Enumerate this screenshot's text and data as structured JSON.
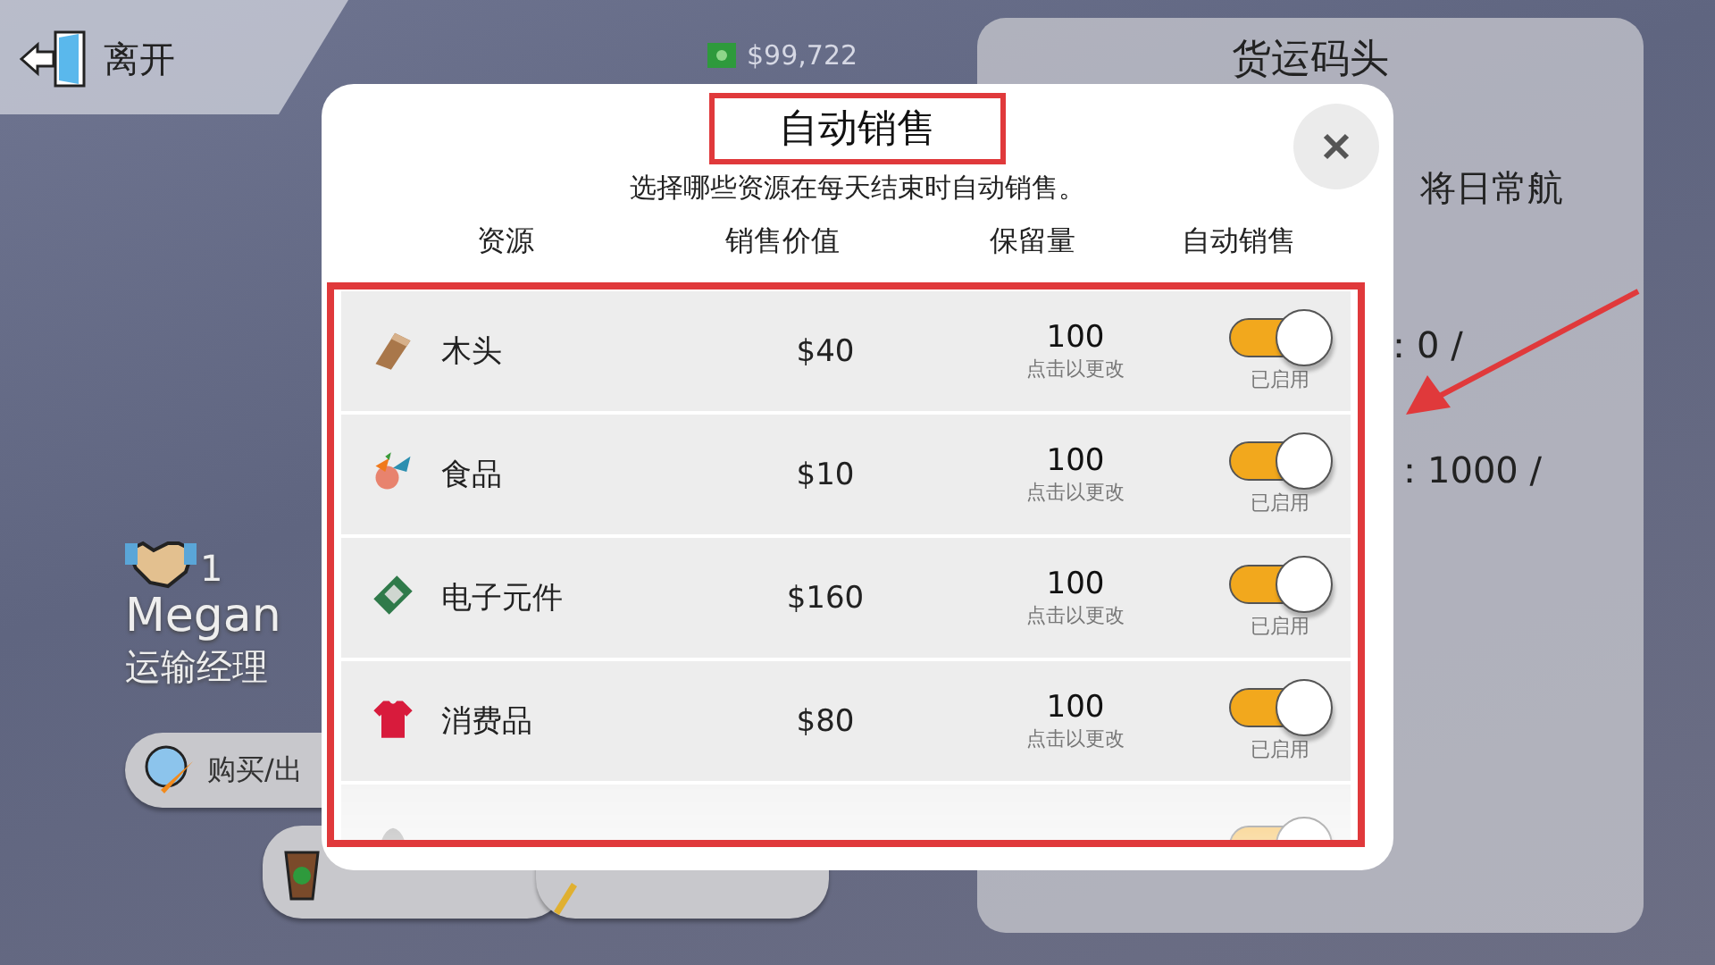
{
  "hud": {
    "exit_label": "离开",
    "money": "$99,722"
  },
  "manager": {
    "level": "1",
    "name": "Megan",
    "role": "运输经理",
    "trade_button": "购买/出"
  },
  "dock_panel": {
    "title": "货运码头",
    "line_1": "将日常航",
    "line_2": "：0 /",
    "line_3": "：1000 /"
  },
  "dialog": {
    "title": "自动销售",
    "subtitle": "选择哪些资源在每天结束时自动销售。",
    "columns": [
      "资源",
      "销售价值",
      "保留量",
      "自动销售"
    ],
    "rows": [
      {
        "kind": "wood",
        "name": "木头",
        "price": "$40",
        "reserve": "100",
        "hint": "点击以更改",
        "on": true,
        "status": "已启用"
      },
      {
        "kind": "food",
        "name": "食品",
        "price": "$10",
        "reserve": "100",
        "hint": "点击以更改",
        "on": true,
        "status": "已启用"
      },
      {
        "kind": "chip",
        "name": "电子元件",
        "price": "$160",
        "reserve": "100",
        "hint": "点击以更改",
        "on": true,
        "status": "已启用"
      },
      {
        "kind": "shirt",
        "name": "消费品",
        "price": "$80",
        "reserve": "100",
        "hint": "点击以更改",
        "on": true,
        "status": "已启用"
      },
      {
        "kind": "ore",
        "on": true
      }
    ]
  }
}
